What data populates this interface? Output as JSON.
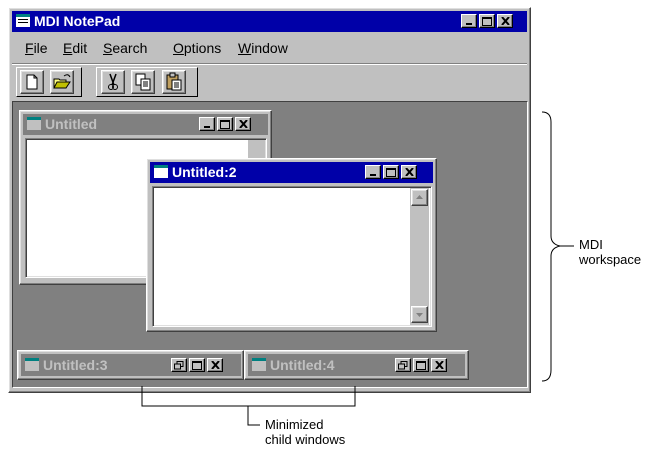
{
  "app": {
    "title": "MDI NotePad"
  },
  "menu": [
    {
      "label": "File",
      "u": "F",
      "rest": "ile"
    },
    {
      "label": "Edit",
      "u": "E",
      "rest": "dit"
    },
    {
      "label": "Search",
      "u": "S",
      "rest": "earch"
    },
    {
      "label": "Options",
      "u": "O",
      "rest": "ptions"
    },
    {
      "label": "Window",
      "u": "W",
      "rest": "indow"
    }
  ],
  "toolbar": [
    {
      "name": "new-file-button",
      "icon": "new-file-icon"
    },
    {
      "name": "open-file-button",
      "icon": "open-folder-icon"
    },
    {
      "name": "cut-button",
      "icon": "scissors-icon"
    },
    {
      "name": "copy-button",
      "icon": "copy-icon"
    },
    {
      "name": "paste-button",
      "icon": "clipboard-icon"
    }
  ],
  "children": {
    "doc1": {
      "title": "Untitled",
      "state": "inactive"
    },
    "doc2": {
      "title": "Untitled:2",
      "state": "active"
    },
    "doc3": {
      "title": "Untitled:3",
      "state": "minimized"
    },
    "doc4": {
      "title": "Untitled:4",
      "state": "minimized"
    }
  },
  "annotations": {
    "workspace": {
      "line1": "MDI",
      "line2": "workspace"
    },
    "minimized": {
      "line1": "Minimized",
      "line2": "child windows"
    }
  },
  "colors": {
    "active_title": "#0000a8",
    "inactive_title": "#808080",
    "workspace": "#808080",
    "face": "#c0c0c0"
  }
}
